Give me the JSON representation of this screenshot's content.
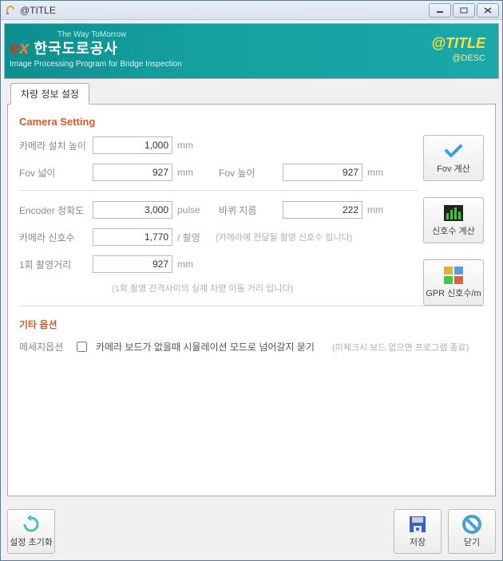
{
  "window": {
    "title": "@TITLE"
  },
  "banner": {
    "slogan": "The Way ToMorrow",
    "org": "한국도로공사",
    "subtitle": "Image Processing Program for Bridge Inspection",
    "title": "@TITLE",
    "desc": "@DESC"
  },
  "tab": {
    "label": "차량 정보 설정"
  },
  "camera": {
    "section_title": "Camera Setting",
    "height_label": "카메라 설치 높이",
    "height_value": "1,000",
    "height_unit": "mm",
    "fov_width_label": "Fov 넓이",
    "fov_width_value": "927",
    "fov_width_unit": "mm",
    "fov_height_label": "Fov 높이",
    "fov_height_value": "927",
    "fov_height_unit": "mm",
    "encoder_label": "Encoder 정확도",
    "encoder_value": "3,000",
    "encoder_unit": "pulse",
    "wheel_label": "바퀴 지름",
    "wheel_value": "222",
    "wheel_unit": "mm",
    "signal_label": "카메라 신호수",
    "signal_value": "1,770",
    "signal_unit": "/ 촬영",
    "signal_hint": "(카메라에 전달될 촬영 신호수 입니다)",
    "dist_label": "1회 촬영거리",
    "dist_value": "927",
    "dist_unit": "mm",
    "dist_hint": "(1회 촬영 간격사이의 실제 차량 이동 거리 입니다)"
  },
  "side_buttons": {
    "fov_calc": "Fov 계산",
    "signal_calc": "신호수 계산",
    "gpr_calc": "GPR 신호수/m"
  },
  "other": {
    "title": "기타 옵션",
    "msg_label": "메세지옵션",
    "checkbox_text": "카메라 보드가 없을때 시뮬레이션 모드로 넘어갈지 묻기",
    "checkbox_hint": "(미체크시 보드 없으면 프로그램 종료)"
  },
  "bottom": {
    "reset": "설정 초기화",
    "save": "저장",
    "close": "닫기"
  }
}
